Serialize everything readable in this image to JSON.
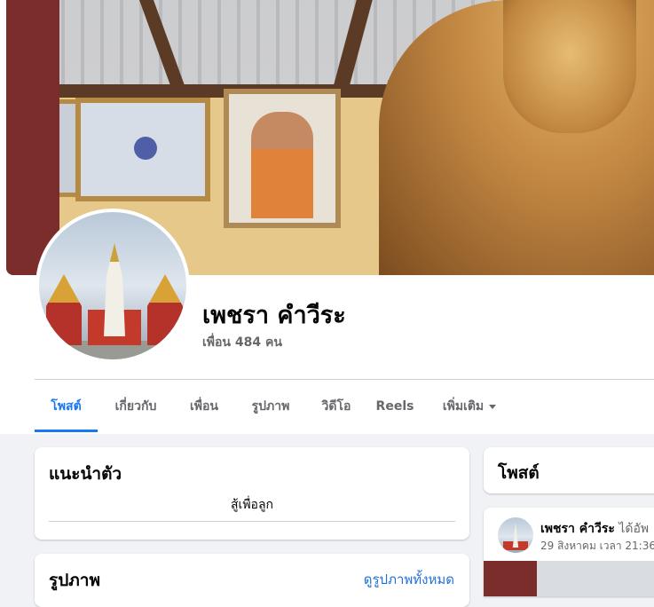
{
  "profile": {
    "name": "เพชรา คำวีระ",
    "friends": "เพื่อน 484 คน"
  },
  "tabs": [
    {
      "label": "โพสต์",
      "active": true
    },
    {
      "label": "เกี่ยวกับ"
    },
    {
      "label": "เพื่อน"
    },
    {
      "label": "รูปภาพ"
    },
    {
      "label": "วิดีโอ"
    },
    {
      "label": "Reels"
    },
    {
      "label": "เพิ่มเติม"
    }
  ],
  "intro": {
    "title": "แนะนำตัว",
    "bio": "สู้เพื่อลูก"
  },
  "photos": {
    "title": "รูปภาพ",
    "see_all": "ดูรูปภาพทั้งหมด"
  },
  "posts": {
    "title": "โพสต์"
  },
  "post": {
    "author": "เพชรา คำวีระ",
    "action": "ได้อัพ",
    "timestamp": "29 สิงหาคม เวลา 21:36"
  },
  "colors": {
    "accent": "#1877f2",
    "link": "#216fdb",
    "secondary_text": "#65676b",
    "background": "#f0f2f5"
  }
}
